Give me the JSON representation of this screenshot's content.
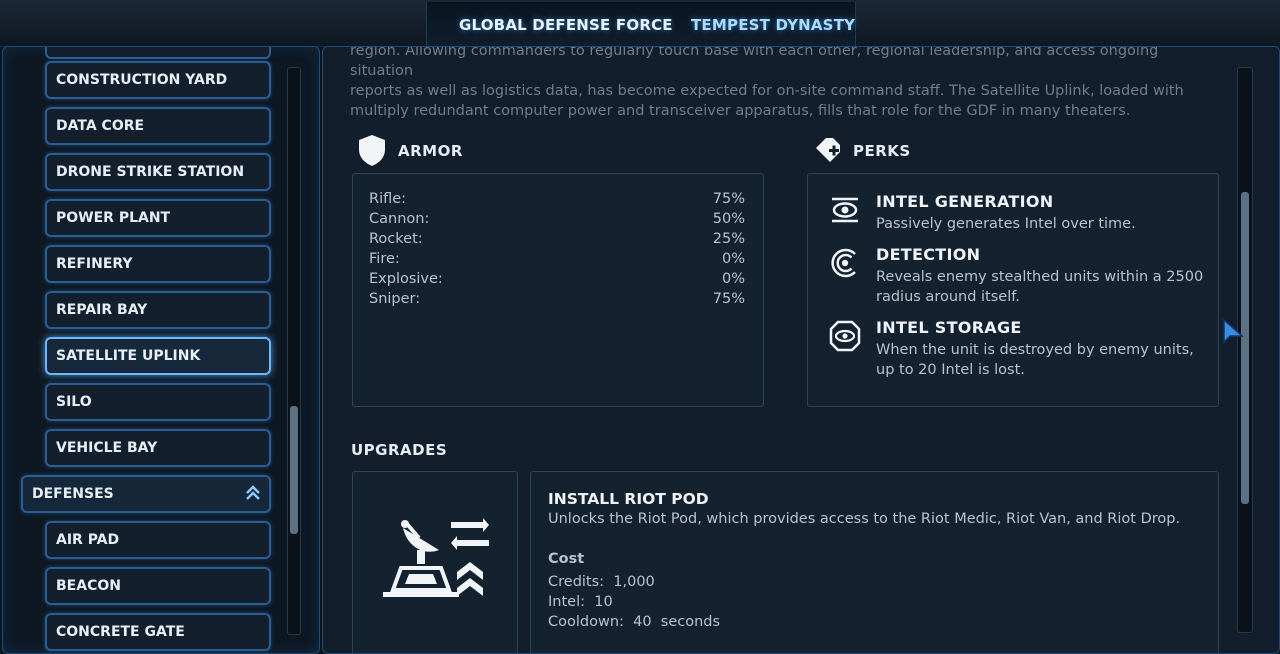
{
  "tabs": [
    "GLOBAL DEFENSE FORCE",
    "TEMPEST DYNASTY"
  ],
  "sidebar": {
    "items": [
      "CONSTRUCTION YARD",
      "DATA CORE",
      "DRONE STRIKE STATION",
      "POWER PLANT",
      "REFINERY",
      "REPAIR BAY",
      "SATELLITE UPLINK",
      "SILO",
      "VEHICLE BAY"
    ],
    "selected": "SATELLITE UPLINK",
    "category": "DEFENSES",
    "category_items": [
      "AIR PAD",
      "BEACON",
      "CONCRETE GATE"
    ]
  },
  "intro": {
    "line1": "region. Allowing commanders to regularly touch base with each other, regional leadership, and access ongoing situation",
    "line2": "reports as well as logistics data, has become expected for on-site command staff. The Satellite Uplink, loaded with",
    "line3": "multiply redundant computer power and transceiver apparatus, fills that role for the GDF in many theaters."
  },
  "armor": {
    "heading": "ARMOR",
    "rows": [
      {
        "label": "Rifle:",
        "value": "75%"
      },
      {
        "label": "Cannon:",
        "value": "50%"
      },
      {
        "label": "Rocket:",
        "value": "25%"
      },
      {
        "label": "Fire:",
        "value": "0%"
      },
      {
        "label": "Explosive:",
        "value": "0%"
      },
      {
        "label": "Sniper:",
        "value": "75%"
      }
    ]
  },
  "perks": {
    "heading": "PERKS",
    "items": [
      {
        "title": "INTEL GENERATION",
        "desc": "Passively generates Intel over time.",
        "icon": "intel-generation-icon"
      },
      {
        "title": "DETECTION",
        "desc": "Reveals enemy stealthed units within a 2500 radius around itself.",
        "icon": "detection-icon"
      },
      {
        "title": "INTEL STORAGE",
        "desc": "When the unit is destroyed by enemy units, up to 20 Intel is lost.",
        "icon": "intel-storage-icon"
      }
    ]
  },
  "upgrades": {
    "heading": "UPGRADES",
    "title": "INSTALL RIOT POD",
    "desc": "Unlocks the Riot Pod, which provides access to the Riot Medic, Riot Van, and Riot Drop.",
    "cost_heading": "Cost",
    "credits_label": "Credits:",
    "credits": "1,000",
    "intel_label": "Intel:",
    "intel": "10",
    "cooldown_label": "Cooldown:",
    "cooldown": "40",
    "cooldown_unit": "seconds"
  }
}
